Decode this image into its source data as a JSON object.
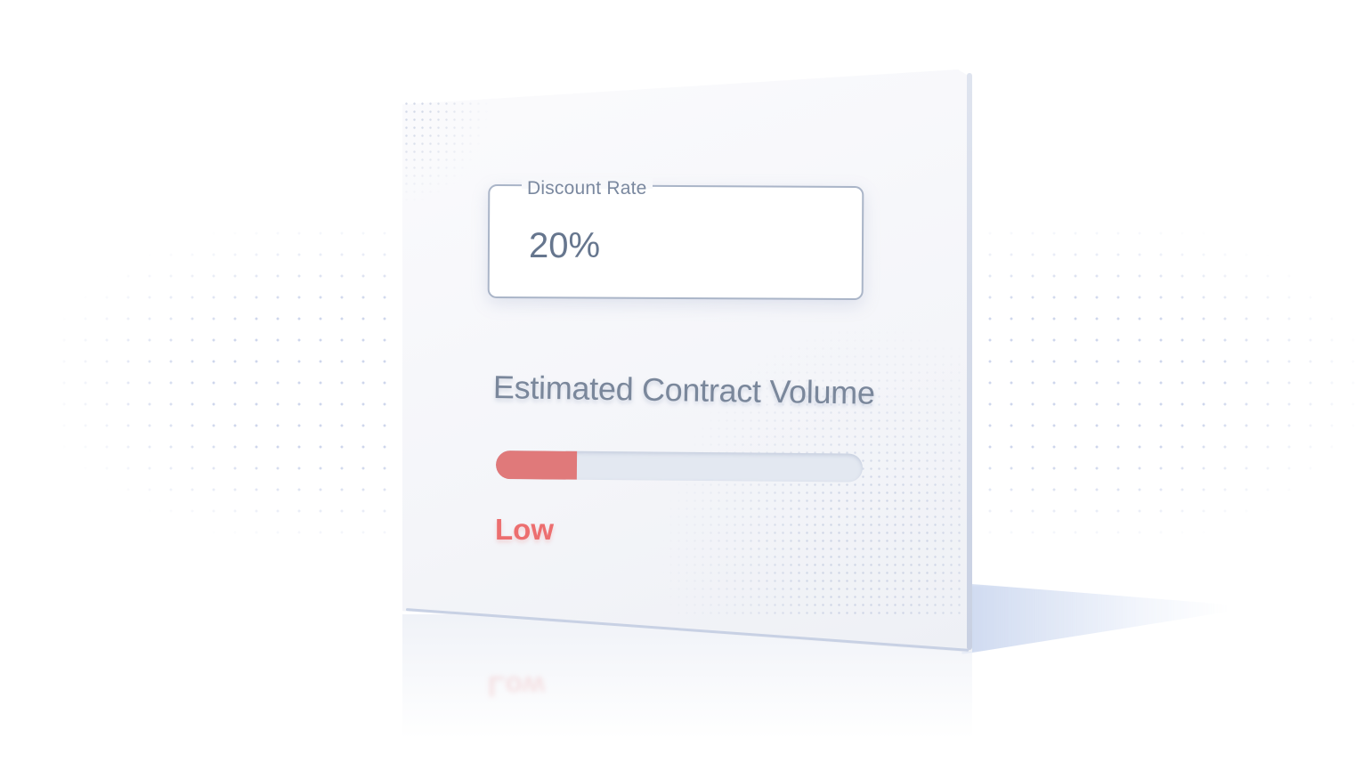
{
  "discount_field": {
    "label": "Discount Rate",
    "value": "20%"
  },
  "contract_volume": {
    "title": "Estimated Contract Volume",
    "level_label": "Low",
    "progress_fraction": 0.22,
    "fill_color": "#e0797a",
    "label_color": "#ec6e6f"
  }
}
